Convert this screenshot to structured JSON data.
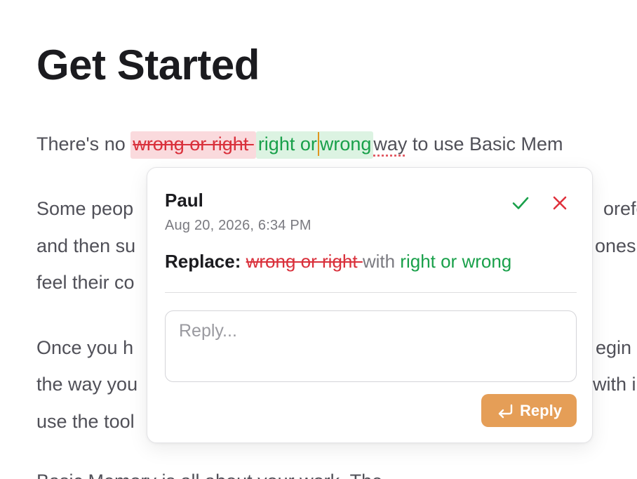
{
  "document": {
    "title": "Get Started",
    "para1": {
      "before": "There's no ",
      "deleted": "wrong or right ",
      "inserted_a": "right or",
      "inserted_b": "wrong",
      "after_word": "way",
      "after_rest": " to use Basic Mem"
    },
    "para2": {
      "line1_left": "Some peop",
      "line1_right": "orefe",
      "line2_left": "and then su",
      "line2_right": "ones",
      "line3_left": "feel their co"
    },
    "para3": {
      "line1_left": "Once you h",
      "line1_right": "egin",
      "line2_left": "the way you",
      "line2_right": "with i",
      "line3_left": "use the tool"
    },
    "para4": {
      "line1_left": "Basic Memory is all about your work. The"
    }
  },
  "comment": {
    "author": "Paul",
    "timestamp": "Aug 20, 2026, 6:34 PM",
    "replace_label": "Replace:",
    "old_text": "wrong or right ",
    "with_word": "with",
    "new_text": "right or wrong",
    "reply_placeholder": "Reply...",
    "reply_button": "Reply"
  },
  "colors": {
    "accept": "#19a04a",
    "reject": "#e0313c",
    "reply_button": "#e59e57"
  },
  "icons": {
    "accept": "check-icon",
    "reject": "close-icon",
    "reply": "return-arrow-icon"
  }
}
